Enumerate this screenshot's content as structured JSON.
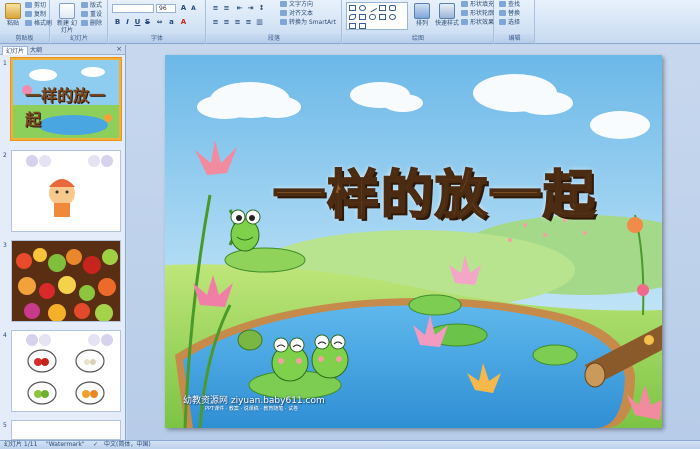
{
  "ribbon": {
    "clipboard": {
      "label": "剪贴板",
      "paste": "粘贴",
      "cut": "剪切",
      "copy": "复制",
      "format_painter": "格式刷"
    },
    "slides": {
      "label": "幻灯片",
      "new_slide": "新建\n幻灯片",
      "layout": "版式",
      "reset": "重设",
      "delete": "删除"
    },
    "font": {
      "label": "字体",
      "font_name": "",
      "font_size": "96"
    },
    "paragraph": {
      "label": "段落",
      "text_direction": "文字方向",
      "align_text": "对齐文本",
      "smartart": "转换为 SmartArt"
    },
    "drawing": {
      "label": "绘图",
      "arrange": "排列",
      "quick_styles": "快速样式",
      "shape_fill": "形状填充",
      "shape_outline": "形状轮廓",
      "shape_effects": "形状效果"
    },
    "editing": {
      "label": "编辑",
      "find": "查找",
      "replace": "替换",
      "select": "选择"
    }
  },
  "leftpanel": {
    "tab_slides": "幻灯片",
    "tab_outline": "大纲",
    "close": "×",
    "slides": [
      {
        "num": "1",
        "title": "一样的放一起"
      },
      {
        "num": "2"
      },
      {
        "num": "3"
      },
      {
        "num": "4"
      },
      {
        "num": "5"
      }
    ]
  },
  "slide": {
    "title": "一样的放一起",
    "watermark": "幼教资源网 ziyuan.baby611.com",
    "watermark_sub": "PPT课件 · 教案 · 说课稿 · 教育随笔 · 试卷"
  },
  "statusbar": {
    "slide_counter": "幻灯片 1/11",
    "theme": "\"Watermark\"",
    "language": "中文(简体，中国)"
  },
  "colors": {
    "ribbon_bg": "#d6e5f6",
    "selected_thumb_border": "#f0b13c",
    "title_text": "#8a5a2c"
  }
}
